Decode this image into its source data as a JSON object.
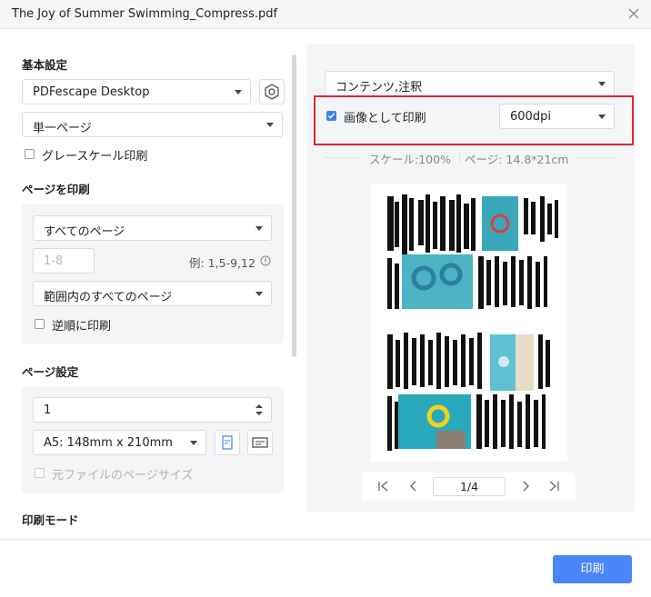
{
  "window": {
    "title": "The Joy of Summer Swimming_Compress.pdf"
  },
  "basic": {
    "heading": "基本設定",
    "printer": "PDFescape Desktop",
    "pages_mode": "単一ページ",
    "grayscale_label": "グレースケール印刷"
  },
  "print_pages": {
    "heading": "ページを印刷",
    "range": "すべてのページ",
    "range_placeholder": "1-8",
    "example": "例: 1,5-9,12",
    "subset": "範囲内のすべてのページ",
    "reverse_label": "逆順に印刷"
  },
  "page_setup": {
    "heading": "ページ設定",
    "copies": "1",
    "paper": "A5: 148mm x 210mm",
    "original_size_label": "元ファイルのページサイズ"
  },
  "print_mode": {
    "heading": "印刷モード"
  },
  "right": {
    "content": "コンテンツ,注釈",
    "as_image_label": "画像として印刷",
    "dpi": "600dpi",
    "scale": "スケール:100%",
    "page_size": "ページ: 14.8*21cm",
    "page_indicator": "1/4"
  },
  "footer": {
    "print_label": "印刷"
  },
  "colors": {
    "accent": "#4a86f7",
    "highlight": "#d8282f",
    "pool": "#3aa7b8"
  }
}
